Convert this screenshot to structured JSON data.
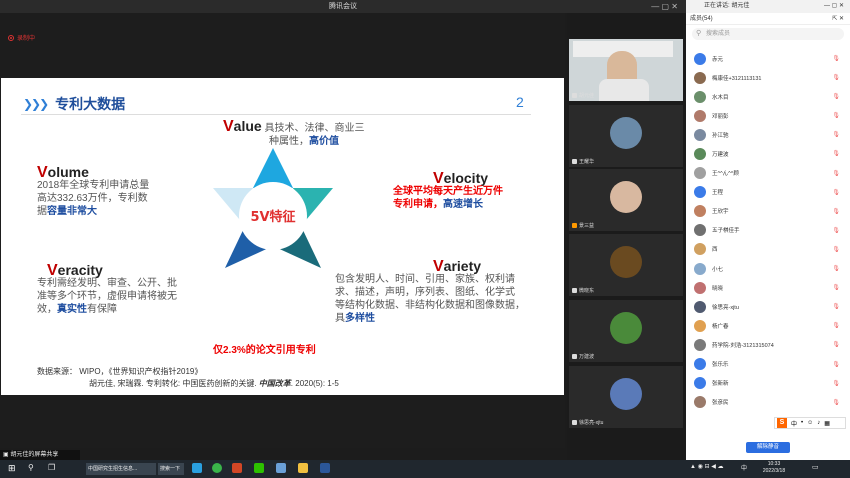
{
  "window": {
    "title": "腾讯会议"
  },
  "recording": {
    "label": "录制中"
  },
  "slide": {
    "title": "专利大数据",
    "number": "2",
    "center": "5V特征",
    "value_head": "V",
    "value_rest": "alue",
    "value_text1": "具技术、法律、商业三",
    "value_text2": "种属性，",
    "value_hl": "高价值",
    "volume_head": "V",
    "volume_rest": "olume",
    "volume_text1": "2018年全球专利申请总量",
    "volume_text2": "高达332.63万件，专利数",
    "volume_text3": "据",
    "volume_hl": "容量非常大",
    "velocity_head": "V",
    "velocity_rest": "elocity",
    "velocity_text1": "全球平均每天产生近万件",
    "velocity_text2": "专利申请，",
    "velocity_hl": "高速增长",
    "veracity_head": "V",
    "veracity_rest": "eracity",
    "veracity_text1": "专利需经发明、审查、公开、批",
    "veracity_text2": "准等多个环节，虚假申请将被无",
    "veracity_text3": "效，",
    "veracity_hl": "真实性",
    "veracity_text4": "有保障",
    "variety_head": "V",
    "variety_rest": "ariety",
    "variety_text1": "包含发明人、时间、引用、家族、权利请",
    "variety_text2": "求、描述，声明，序列表、图纸、化学式",
    "variety_text3": "等结构化数据、非结构化数据和图像数据，",
    "variety_text4": "具",
    "variety_hl": "多样性",
    "cite_note": "仅2.3%的论文引用专利",
    "source1": "数据来源： WIPO，《世界知识产权指针2019》",
    "source2": "胡元佳, 宋瑞霖. 专利转化: 中国医药创新的关键.",
    "source2_em": "中国改革",
    "source2_tail": ". 2020(5): 1-5"
  },
  "videos": [
    {
      "name": "胡元佳"
    },
    {
      "name": "王耀华"
    },
    {
      "name": "景三益"
    },
    {
      "name": "微晓东"
    },
    {
      "name": "万建波"
    },
    {
      "name": "徐思亮-xjtu"
    }
  ],
  "panel": {
    "speaking": "正在讲话: 胡元佳",
    "members_title": "成员(54)",
    "search_placeholder": "搜索成员",
    "mute_all": "解除静音",
    "members": [
      {
        "name": "赤元",
        "color": "#3b7be8"
      },
      {
        "name": "梅康佳+3121113131",
        "color": "#8a6a50"
      },
      {
        "name": "水木目",
        "color": "#6b8f6b"
      },
      {
        "name": "邓丽彭",
        "color": "#b07a6a"
      },
      {
        "name": "孙江驰",
        "color": "#7a8aa0"
      },
      {
        "name": "万建波",
        "color": "#5a8a5a"
      },
      {
        "name": "王^^ん^^顾",
        "color": "#a0a0a0"
      },
      {
        "name": "王程",
        "color": "#3b7be8"
      },
      {
        "name": "王欣宇",
        "color": "#c08060"
      },
      {
        "name": "五子棋佳手",
        "color": "#707070"
      },
      {
        "name": "西",
        "color": "#d0a060"
      },
      {
        "name": "小七",
        "color": "#88aacc"
      },
      {
        "name": "晓晓",
        "color": "#c07070"
      },
      {
        "name": "徐思亮-xjtu",
        "color": "#505a70"
      },
      {
        "name": "杨广春",
        "color": "#e0a050"
      },
      {
        "name": "药学院-刘浩-3121315074",
        "color": "#7a7a7a"
      },
      {
        "name": "张乐乐",
        "color": "#3b7be8"
      },
      {
        "name": "张新新",
        "color": "#3b7be8"
      },
      {
        "name": "张彦民",
        "color": "#9a7a6a"
      }
    ]
  },
  "share_bar": {
    "label": "胡元佳的屏幕共享"
  },
  "taskbar": {
    "task1": "中国研究生招生信息...",
    "task2": "搜索一下",
    "time": "10:33",
    "date": "2022/3/18",
    "lang": "中",
    "ime": "中"
  }
}
